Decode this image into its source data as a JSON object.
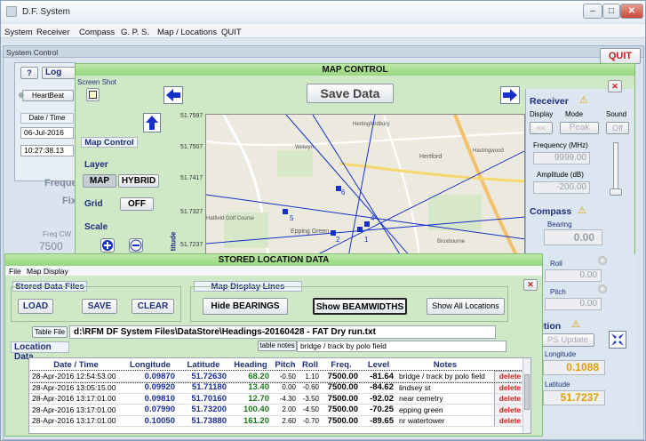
{
  "window": {
    "title": "D.F. System",
    "controls": {
      "min": "–",
      "max": "□",
      "close": "✕"
    }
  },
  "menu": [
    "System",
    "Receiver",
    "Compass",
    "G. P. S.",
    "Map / Locations",
    "QUIT"
  ],
  "system_control": {
    "title": "System Control",
    "quit": "QUIT",
    "help": "?",
    "log": "Log",
    "heartbeat": "HeartBeat",
    "date_time_label": "Date / Time",
    "date": "06-Jul-2016",
    "time": "10:27:38.13",
    "freq": "Freque",
    "fix": "Fix",
    "freq_cw": "Freq CW",
    "freq_val": "7500"
  },
  "map_control": {
    "title": "MAP CONTROL",
    "screenshot": "Screen Shot",
    "save_data": "Save Data",
    "section": "Map Control",
    "layer_label": "Layer",
    "map": "MAP",
    "hybrid": "HYBRID",
    "grid_label": "Grid",
    "grid_value": "OFF",
    "scale_label": "Scale",
    "lat_ticks": [
      "51.7597",
      "51.7507",
      "51.7417",
      "51.7327",
      "51.7237"
    ],
    "lat_axis": "titude",
    "places": [
      "Welwyn",
      "Hertingfordbury",
      "Hertford",
      "Hastingwood",
      "Epping Green",
      "Hatfield Golf Course",
      "Broxbourne"
    ],
    "markers": [
      "1",
      "2",
      "5",
      "6",
      "4"
    ]
  },
  "receiver": {
    "title": "Receiver",
    "display": "Display",
    "mode": "Mode",
    "sound": "Sound",
    "back": "<<",
    "peak": "Peak",
    "off": "Off",
    "freq_label": "Frequency (MHz)",
    "freq_value": "9999.00",
    "amp_label": "Amplitude (dB)",
    "amp_value": "-200.00"
  },
  "compass": {
    "title": "Compass",
    "bearing_label": "Bearing",
    "bearing_value": "0.00",
    "roll_label": "Roll",
    "roll_value": "0.00",
    "pitch_label": "Pitch",
    "pitch_value": "0.00"
  },
  "gps": {
    "title": "ition",
    "update": "PS Update",
    "long_label": "Longitude",
    "long_value": "0.1088",
    "lat_label": "Latitude",
    "lat_value": "51.7237"
  },
  "stored": {
    "title": "STORED LOCATION DATA",
    "menu": [
      "File",
      "Map Display"
    ],
    "files_group": "Stored Data Files",
    "load": "LOAD",
    "save": "SAVE",
    "clear": "CLEAR",
    "lines_group": "Map Display Lines",
    "hide_bearings": "Hide BEARINGS",
    "show_beamwidths": "Show BEAMWIDTHS",
    "show_all": "Show All Locations",
    "table_file_label": "Table File",
    "table_file": "d:\\RFM DF System Files\\DataStore\\Headings-20160428 - FAT Dry run.txt",
    "location_data": "Location Data",
    "table_notes_label": "table notes",
    "table_notes": "bridge / track by polo field",
    "columns": [
      "Date / Time",
      "Longitude",
      "Latitude",
      "Heading",
      "Pitch",
      "Roll",
      "Freq.",
      "Level",
      "Notes"
    ],
    "delete": "delete",
    "rows": [
      [
        "28-Apr-2016 12:54:53.00",
        "0.09870",
        "51.72630",
        "68.20",
        "-0.50",
        "1.10",
        "7500.00",
        "-81.64",
        "bridge / track by polo field"
      ],
      [
        "28-Apr-2016 13:05:15.00",
        "0.09920",
        "51.71180",
        "13.40",
        "0.00",
        "-0.60",
        "7500.00",
        "-84.62",
        "lindsey st"
      ],
      [
        "28-Apr-2016 13:17:01.00",
        "0.09810",
        "51.70160",
        "12.70",
        "-4.30",
        "-3.50",
        "7500.00",
        "-92.02",
        "near cemetry"
      ],
      [
        "28-Apr-2016 13:17:01.00",
        "0.07990",
        "51.73200",
        "100.40",
        "2.00",
        "-4.50",
        "7500.00",
        "-70.25",
        "epping green"
      ],
      [
        "28-Apr-2016 13:17:01.00",
        "0.10050",
        "51.73880",
        "161.20",
        "2.60",
        "-0.70",
        "7500.00",
        "-89.65",
        "nr watertower"
      ]
    ]
  },
  "colors": {
    "accent": "#1e2f7a",
    "quit": "#c81e1e",
    "green_panel": "#cfe9c7",
    "value_yellow": "#e0a000"
  }
}
